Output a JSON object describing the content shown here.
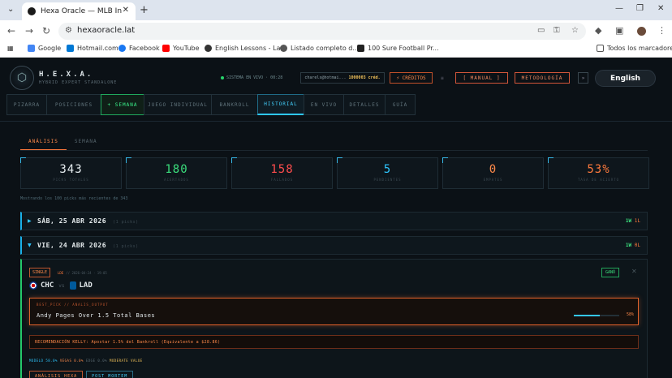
{
  "browser": {
    "tab_title": "Hexa Oracle — MLB Intelligence",
    "close_glyph": "✕",
    "new_tab_glyph": "+",
    "url": "hexaoracle.lat",
    "bookmarks": [
      {
        "label": "Google",
        "color": "#4285f4"
      },
      {
        "label": "Hotmail.com",
        "color": "#0078d4"
      },
      {
        "label": "Facebook",
        "color": "#1877f2"
      },
      {
        "label": "YouTube",
        "color": "#ff0000"
      },
      {
        "label": "English Lessons - La...",
        "color": "#333333"
      },
      {
        "label": "Listado completo d...",
        "color": "#555555"
      },
      {
        "label": "100 Sure Football Pr...",
        "color": "#222222"
      }
    ],
    "all_bookmarks": "Todos los marcadores"
  },
  "header": {
    "brand_name": "H.E.X.A.",
    "brand_sub": "HYBRID EXPERT STANDALONE",
    "status": "SISTEMA EN VIVO · 00:28",
    "credits_user": "charels@hotmai...",
    "credits_amount": "1000003 créd.",
    "creditos_btn": "⚡ CRÉDITOS",
    "tiny": "≡",
    "manual_btn": "[ MANUAL ]",
    "metodologia_btn": "METODOLOGÍA",
    "arrow_btn": "»",
    "language": "English"
  },
  "nav_tabs": [
    {
      "label": "PIZARRA",
      "state": "normal"
    },
    {
      "label": "POSICIONES",
      "state": "normal"
    },
    {
      "label": "+ SEMANA",
      "state": "green"
    },
    {
      "label": "JUEGO INDIVIDUAL",
      "state": "normal"
    },
    {
      "label": "BANKROLL",
      "state": "normal"
    },
    {
      "label": "HISTORIAL",
      "state": "active"
    },
    {
      "label": "EN VIVO",
      "state": "normal"
    },
    {
      "label": "DETALLES",
      "state": "normal"
    },
    {
      "label": "GUÍA",
      "state": "normal"
    }
  ],
  "sub_tabs": [
    {
      "label": "ANÁLISIS",
      "active": true
    },
    {
      "label": "SEMANA",
      "active": false
    }
  ],
  "stats": [
    {
      "value": "343",
      "label": "PICKS TOTALES",
      "color": "#e6edf0"
    },
    {
      "value": "180",
      "label": "ACERTADOS",
      "color": "#3be07d"
    },
    {
      "value": "158",
      "label": "FALLADOS",
      "color": "#ff4d4d"
    },
    {
      "value": "5",
      "label": "PENDIENTES",
      "color": "#2ec7ff"
    },
    {
      "value": "0",
      "label": "EMPATES",
      "color": "#ff8a4a"
    },
    {
      "value": "53%",
      "label": "TASA DE ACIERTO",
      "color": "#ff7a3d"
    }
  ],
  "showing_text": "Mostrando los 100 picks más recientes de 343",
  "days": [
    {
      "arrow": "▶",
      "date": "SÁB, 25 ABR 2026",
      "picks": "(1 picks)",
      "w": "1W",
      "l": "1L"
    },
    {
      "arrow": "▼",
      "date": "VIE, 24 ABR 2026",
      "picks": "(1 picks)",
      "w": "1W",
      "l": "0L"
    }
  ],
  "pick": {
    "type_badge": "SINGLE",
    "league": "LDE",
    "meta": "// 2026-04-24 · 19:05",
    "result": "GANÓ",
    "close": "✕",
    "away": "CHC",
    "vs": "vs",
    "home": "LAD",
    "best_label": "BEST_PICK // ANALIS_OUTPUT",
    "best_text": "Andy Pages Over 1.5 Total Bases",
    "confidence_pct": 58,
    "confidence_label": "58%",
    "kelly": "RECOMENDACIÓN KELLY: Apostar 1.5% del Bankroll (Equivalente a $28.86)",
    "model": "MODELO 58.0%",
    "vegas": "VEGAS 0.0%",
    "edge": "EDGE 0.0%",
    "value": "MODERATE VALUE",
    "tabs": [
      {
        "label": "ANÁLISIS HEXA",
        "style": "orange"
      },
      {
        "label": "POST MORTEM",
        "style": "blue"
      }
    ]
  }
}
